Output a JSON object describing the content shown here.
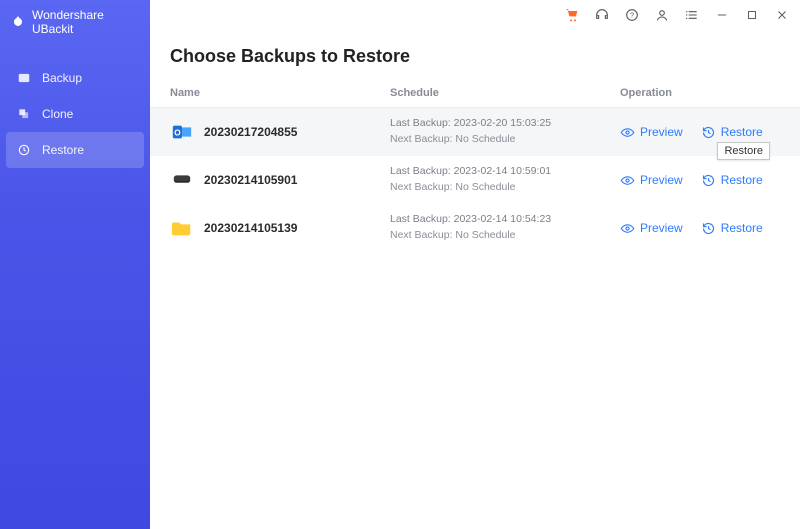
{
  "app": {
    "title": "Wondershare UBackit"
  },
  "sidebar": {
    "items": [
      {
        "label": "Backup",
        "active": false
      },
      {
        "label": "Clone",
        "active": false
      },
      {
        "label": "Restore",
        "active": true
      }
    ]
  },
  "main": {
    "heading": "Choose Backups to Restore",
    "columns": {
      "name": "Name",
      "schedule": "Schedule",
      "operation": "Operation"
    },
    "op_labels": {
      "preview": "Preview",
      "restore": "Restore"
    },
    "tooltip": "Restore",
    "backups": [
      {
        "icon": "outlook",
        "name": "20230217204855",
        "last": "Last Backup: 2023-02-20 15:03:25",
        "next": "Next Backup: No Schedule",
        "selected": true
      },
      {
        "icon": "disk",
        "name": "20230214105901",
        "last": "Last Backup: 2023-02-14 10:59:01",
        "next": "Next Backup: No Schedule",
        "selected": false
      },
      {
        "icon": "folder",
        "name": "20230214105139",
        "last": "Last Backup: 2023-02-14 10:54:23",
        "next": "Next Backup: No Schedule",
        "selected": false
      }
    ]
  }
}
